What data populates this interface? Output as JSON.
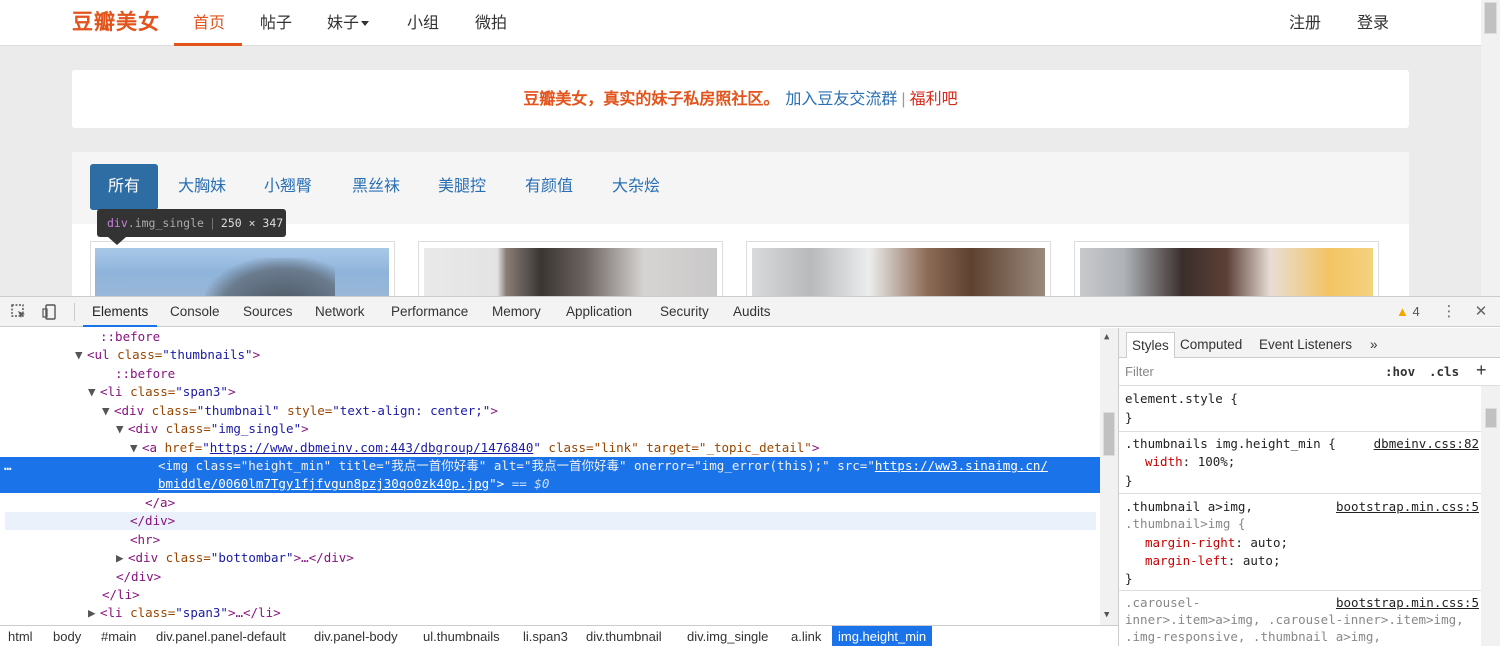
{
  "site": {
    "logo": "豆瓣美女",
    "nav": [
      "首页",
      "帖子",
      "妹子",
      "小组",
      "微拍"
    ],
    "login": "注册",
    "register": "登录",
    "notice": {
      "slogan": "豆瓣美女，真实的妹子私房照社区。",
      "join": "加入豆友交流群",
      "sep": "|",
      "fuli": "福利吧"
    },
    "categories": [
      "所有",
      "大胸妹",
      "小翘臀",
      "黑丝袜",
      "美腿控",
      "有颜值",
      "大杂烩"
    ],
    "tooltip": {
      "tag": "div",
      "cls": ".img_single",
      "sep": "|",
      "size": "250 × 347"
    }
  },
  "devtools": {
    "tabs": [
      "Elements",
      "Console",
      "Sources",
      "Network",
      "Performance",
      "Memory",
      "Application",
      "Security",
      "Audits"
    ],
    "warnings": "4",
    "dom": {
      "before1": "::before",
      "ul": [
        "<ul",
        " class=",
        "\"thumbnails\"",
        ">"
      ],
      "before2": "::before",
      "li": [
        "<li",
        " class=",
        "\"span3\"",
        ">"
      ],
      "div_thumb": [
        "<div",
        " class=",
        "\"thumbnail\"",
        " style=",
        "\"text-align: center;\"",
        ">"
      ],
      "div_img": [
        "<div",
        " class=",
        "\"img_single\"",
        ">"
      ],
      "a_open": "<a",
      "a_href_attr": " href=",
      "a_href": "https://www.dbmeinv.com:443/dbgroup/1476840",
      "a_class": " class=\"link\" target=\"_topic_detail\"",
      "a_close": ">",
      "img_line1": "<img class=\"height_min\" title=\"我点一首你好毒\" alt=\"我点一首你好毒\" onerror=\"img_error(this);\" src=\"",
      "img_src1": "https://ww3.sinaimg.cn/",
      "img_src2": "bmiddle/0060lm7Tgy1fjfvgun8pzj30qo0zk40p.jpg",
      "img_end": "\">",
      "img_eq": " == $0",
      "a_end": "</a>",
      "div_end": "</div>",
      "hr": "<hr>",
      "bottombar": [
        "<div",
        " class=",
        "\"bottombar\"",
        ">…</div>"
      ],
      "div_end2": "</div>",
      "li_end": "</li>",
      "li2": [
        "<li",
        " class=",
        "\"span3\"",
        ">…</li>"
      ],
      "dots": "…"
    },
    "breadcrumbs": [
      "html",
      "body",
      "#main",
      "div.panel.panel-default",
      "div.panel-body",
      "ul.thumbnails",
      "li.span3",
      "div.thumbnail",
      "div.img_single",
      "a.link",
      "img.height_min"
    ],
    "styles": {
      "tabs": [
        "Styles",
        "Computed",
        "Event Listeners",
        "»"
      ],
      "filter": "Filter",
      "hov": ":hov",
      "cls": ".cls",
      "plus": "+",
      "rules": {
        "r1_sel": "element.style {",
        "r1_end": "}",
        "r2_sel": ".thumbnails img.height_min {",
        "r2_src": "dbmeinv.css:82",
        "r2_prop": "width",
        "r2_val": ": 100%;",
        "r2_end": "}",
        "r3_sel1": ".thumbnail a>img,",
        "r3_sel2": ".thumbnail>img {",
        "r3_src": "bootstrap.min.css:5",
        "r3_p1": "margin-right",
        "r3_v1": ": auto;",
        "r3_p2": "margin-left",
        "r3_v2": ": auto;",
        "r3_end": "}",
        "r4_sel1": ".carousel-",
        "r4_sel2": "inner>.item>a>img, .carousel-inner>.item>img,",
        "r4_sel3": ".img-responsive, .thumbnail a>img,",
        "r4_src": "bootstrap.min.css:5"
      }
    }
  }
}
